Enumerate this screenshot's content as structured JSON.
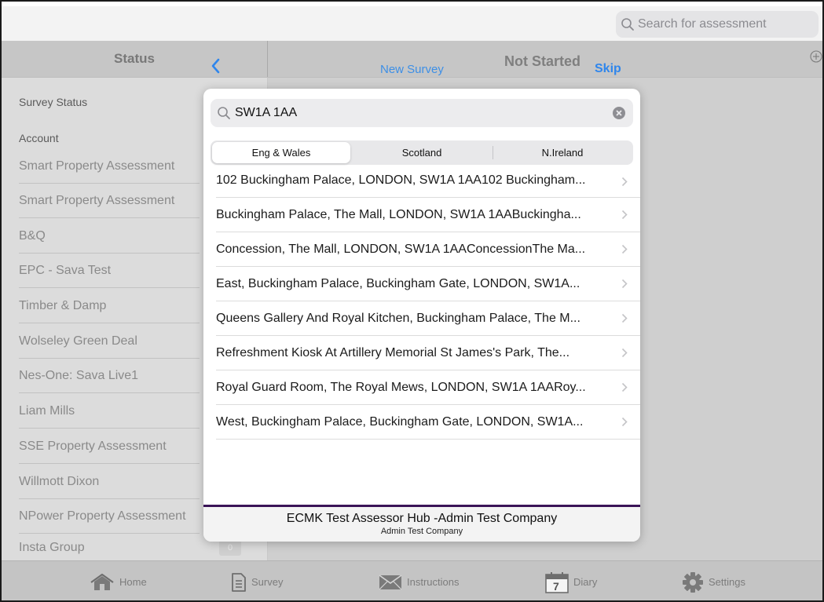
{
  "top_search": {
    "placeholder": "Search for assessment"
  },
  "nav": {
    "status_title": "Status",
    "new_survey": "New Survey",
    "not_started": "Not Started",
    "skip": "Skip"
  },
  "sidebar": {
    "survey_status": "Survey Status",
    "section": "Account",
    "items": [
      "Smart Property Assessment",
      "Smart Property Assessment",
      "B&Q",
      "EPC - Sava Test",
      "Timber & Damp",
      "Wolseley Green Deal",
      "Nes-One: Sava Live1",
      "Liam Mills",
      "SSE Property Assessment",
      "Willmott Dixon",
      "NPower Property Assessment",
      "Insta Group"
    ],
    "badge": "0"
  },
  "modal": {
    "search_value": "SW1A 1AA",
    "segments": [
      "Eng & Wales",
      "Scotland",
      "N.Ireland"
    ],
    "selected_segment": "Eng & Wales",
    "results": [
      "102 Buckingham Palace, LONDON, SW1A 1AA102 Buckingham...",
      "Buckingham Palace, The Mall, LONDON, SW1A 1AABuckingha...",
      "Concession, The Mall, LONDON, SW1A 1AAConcessionThe Ma...",
      "East, Buckingham Palace, Buckingham Gate, LONDON, SW1A...",
      "Queens Gallery And Royal Kitchen, Buckingham Palace, The M...",
      "Refreshment Kiosk At Artillery Memorial St James's Park, The...",
      "Royal Guard Room, The Royal Mews, LONDON, SW1A 1AARoy...",
      "West, Buckingham Palace, Buckingham Gate, LONDON, SW1A..."
    ],
    "footer_title": "ECMK Test Assessor Hub -Admin Test Company",
    "footer_subtitle": "Admin Test Company"
  },
  "tabs": {
    "home": "Home",
    "survey": "Survey",
    "instructions": "Instructions",
    "diary": "Diary",
    "diary_day": "7",
    "settings": "Settings"
  },
  "colors": {
    "accent_blue": "#2f86ec",
    "footer_bar": "#3a1457",
    "header_gray": "#c6c6c6"
  }
}
